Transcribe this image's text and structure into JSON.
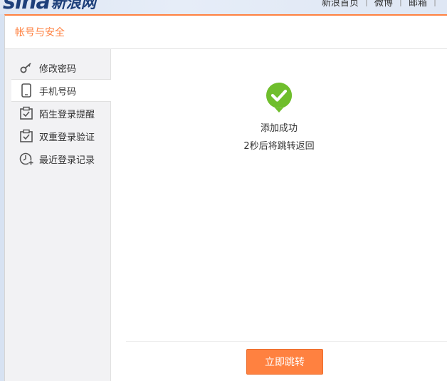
{
  "topbar": {
    "logo_latin": "sina",
    "logo_cn": "新浪网",
    "links": [
      "新浪首页",
      "微博",
      "邮箱"
    ]
  },
  "panel": {
    "title": "帐号与安全"
  },
  "sidebar": {
    "items": [
      {
        "label": "修改密码",
        "icon": "key-icon",
        "active": false
      },
      {
        "label": "手机号码",
        "icon": "phone-icon",
        "active": true
      },
      {
        "label": "陌生登录提醒",
        "icon": "check-box-icon",
        "active": false
      },
      {
        "label": "双重登录验证",
        "icon": "check-box-icon",
        "active": false
      },
      {
        "label": "最近登录记录",
        "icon": "clock-icon",
        "active": false
      }
    ]
  },
  "content": {
    "title": "添加成功",
    "subtitle": "2秒后将跳转返回",
    "button_label": "立即跳转"
  },
  "colors": {
    "accent": "#ff8140",
    "success": "#6fbe2c",
    "sidebar_bg": "#f2f2f4"
  }
}
